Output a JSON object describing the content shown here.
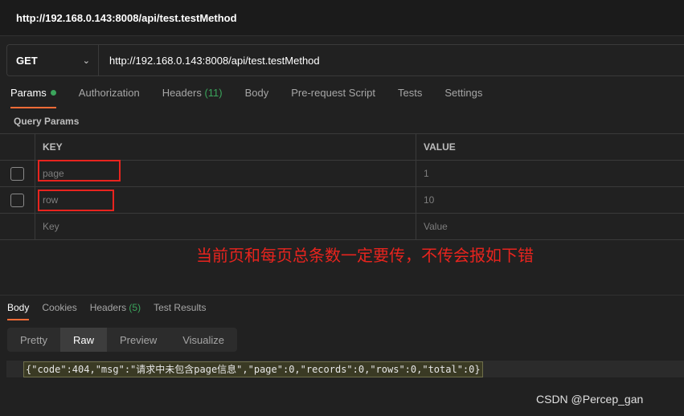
{
  "window": {
    "title": "http://192.168.0.143:8008/api/test.testMethod"
  },
  "request": {
    "method": "GET",
    "url": "http://192.168.0.143:8008/api/test.testMethod"
  },
  "request_tabs": {
    "params": "Params",
    "authorization": "Authorization",
    "headers_label": "Headers",
    "headers_count": "(11)",
    "body": "Body",
    "prerequest": "Pre-request Script",
    "tests": "Tests",
    "settings": "Settings"
  },
  "query_params": {
    "label": "Query Params",
    "header_key": "KEY",
    "header_value": "VALUE",
    "rows": [
      {
        "key": "page",
        "value": "1"
      },
      {
        "key": "row",
        "value": "10"
      }
    ],
    "placeholder_key": "Key",
    "placeholder_value": "Value"
  },
  "annotation": "当前页和每页总条数一定要传，不传会报如下错",
  "response_tabs": {
    "body": "Body",
    "cookies": "Cookies",
    "headers_label": "Headers",
    "headers_count": "(5)",
    "test_results": "Test Results"
  },
  "view_tabs": {
    "pretty": "Pretty",
    "raw": "Raw",
    "preview": "Preview",
    "visualize": "Visualize"
  },
  "response_body": "{\"code\":404,\"msg\":\"请求中未包含page信息\",\"page\":0,\"records\":0,\"rows\":0,\"total\":0}",
  "watermark": "CSDN @Percep_gan",
  "colors": {
    "accent": "#ff6c37",
    "count_green": "#3ba55c",
    "annotation_red": "#e8241e"
  }
}
